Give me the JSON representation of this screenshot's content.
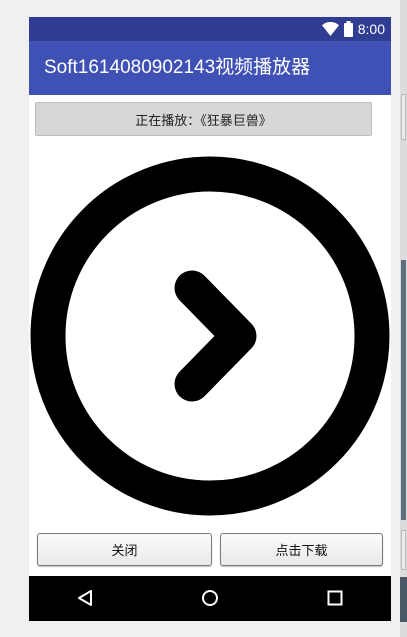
{
  "status_bar": {
    "time": "8:00",
    "icons": [
      "wifi-icon",
      "battery-icon"
    ],
    "background": "#2f3d93"
  },
  "app_bar": {
    "title": "Soft1614080902143视频播放器",
    "background": "#3f51b5"
  },
  "now_playing": {
    "label": "正在播放：《狂暴巨兽》"
  },
  "video": {
    "icon": "play-circle-icon"
  },
  "buttons": {
    "close_label": "关闭",
    "download_label": "点击下载"
  },
  "nav_bar": {
    "icons": [
      "back-icon",
      "home-icon",
      "recents-icon"
    ],
    "background": "#000000"
  }
}
